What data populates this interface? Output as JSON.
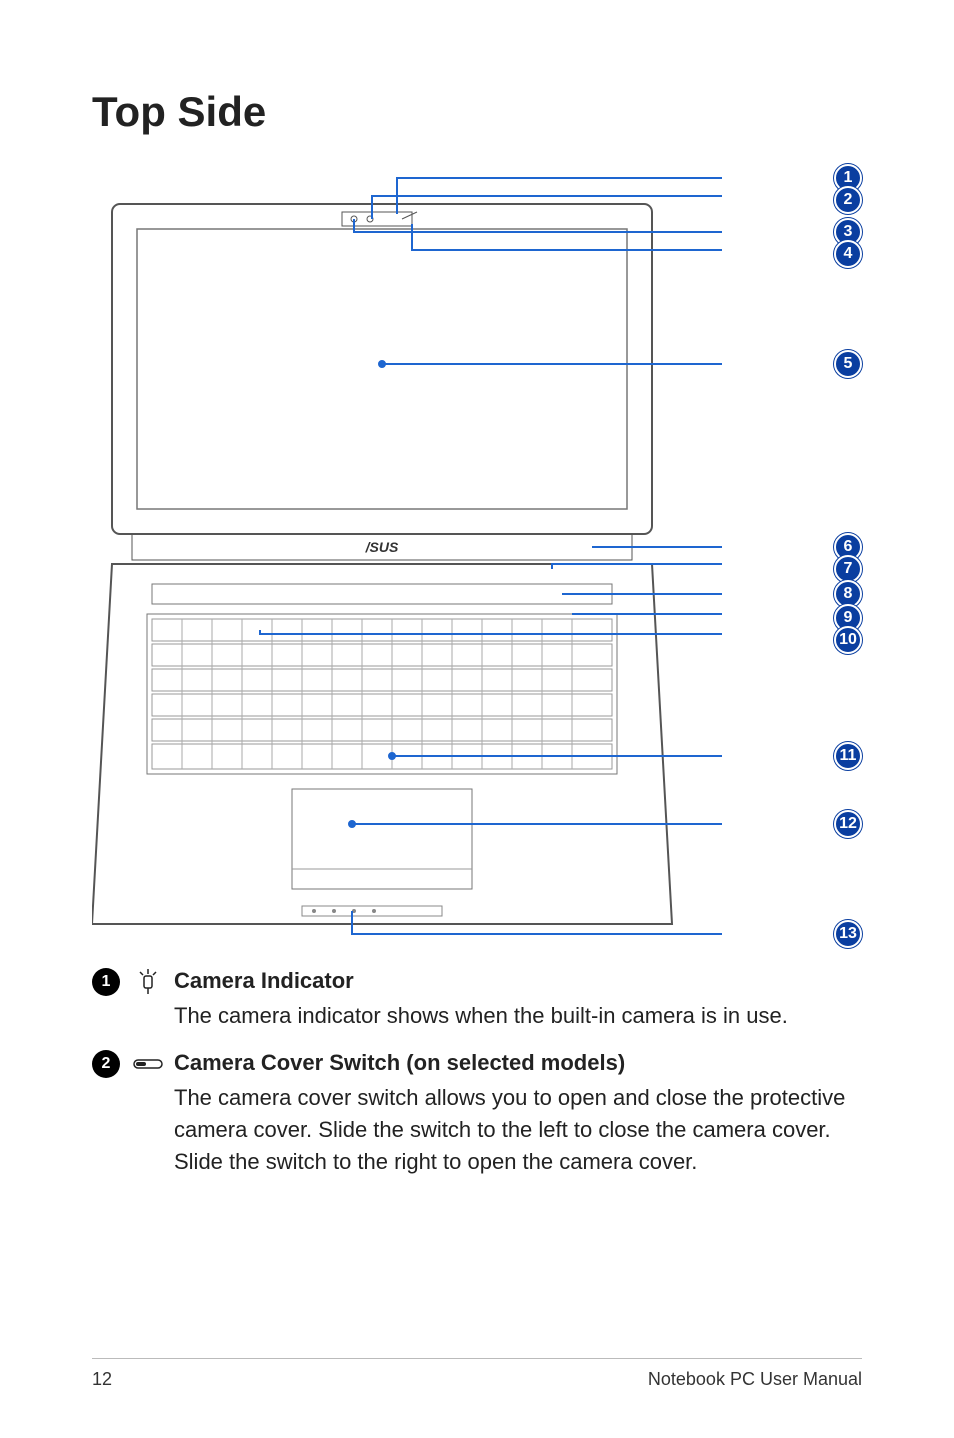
{
  "title": "Top Side",
  "callouts": [
    "1",
    "2",
    "3",
    "4",
    "5",
    "6",
    "7",
    "8",
    "9",
    "10",
    "11",
    "12",
    "13"
  ],
  "items": [
    {
      "num": "1",
      "icon": "camera-indicator-icon",
      "title": "Camera Indicator",
      "body": "The camera indicator shows when the built-in camera is in use."
    },
    {
      "num": "2",
      "icon": "switch-icon",
      "title": "Camera Cover Switch (on selected models)",
      "body": "The camera cover switch allows you to open and close the protective camera cover. Slide the switch to the left to close the camera cover. Slide the switch to the right to open the camera cover."
    }
  ],
  "footer": {
    "page": "12",
    "doc": "Notebook PC User Manual"
  }
}
